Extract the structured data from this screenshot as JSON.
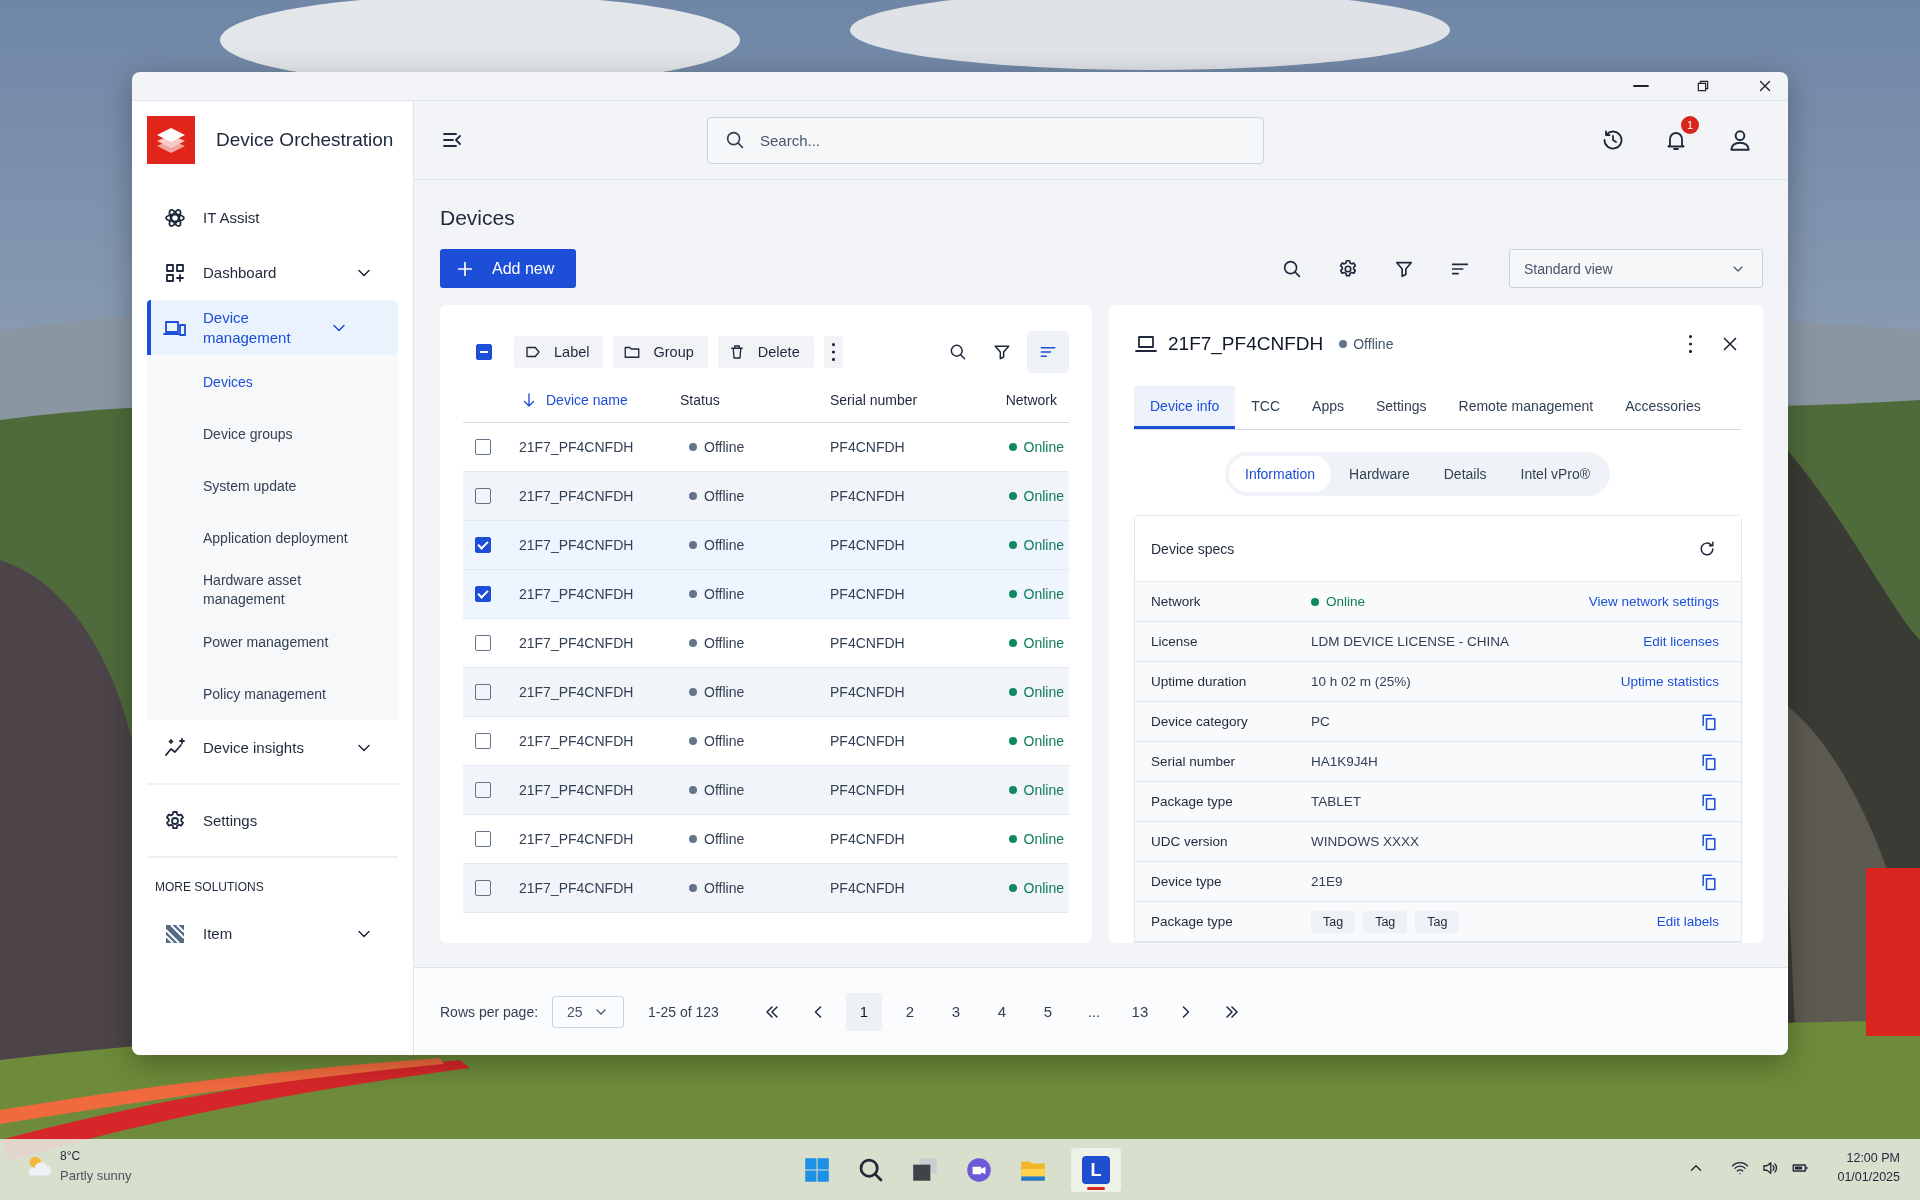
{
  "window": {
    "app_name": "Device Orchestration"
  },
  "sidebar": {
    "groups": [
      {
        "items": [
          {
            "label": "IT Assist",
            "selected": false,
            "expandable": false
          },
          {
            "label": "Dashboard",
            "selected": false,
            "expandable": true
          },
          {
            "label": "Device management",
            "selected": true,
            "expandable": true,
            "children": [
              {
                "label": "Devices",
                "selected": true
              },
              {
                "label": "Device groups",
                "selected": false
              },
              {
                "label": "System update",
                "selected": false
              },
              {
                "label": "Application deployment",
                "selected": false
              },
              {
                "label": "Hardware asset management",
                "selected": false
              },
              {
                "label": "Power management",
                "selected": false
              },
              {
                "label": "Policy management",
                "selected": false
              }
            ]
          },
          {
            "label": "Device insights",
            "selected": false,
            "expandable": true
          }
        ]
      },
      {
        "items": [
          {
            "label": "Settings",
            "selected": false,
            "expandable": false
          }
        ]
      },
      {
        "title": "MORE SOLUTIONS",
        "items": [
          {
            "label": "Item",
            "selected": false,
            "expandable": true
          }
        ]
      }
    ]
  },
  "header": {
    "search": {
      "placeholder": "Search..."
    },
    "notification_count": "1"
  },
  "page": {
    "title": "Devices",
    "add_button": "Add new",
    "view_select": "Standard view"
  },
  "table": {
    "select_all": {
      "indeterminate": true
    },
    "actions": [
      "Label",
      "Group",
      "Delete"
    ],
    "tools": [
      {
        "kind": "search",
        "active": false
      },
      {
        "kind": "filter",
        "active": false
      },
      {
        "kind": "sort",
        "active": true
      }
    ],
    "columns": [
      {
        "label": "Device name",
        "sorted": true
      },
      {
        "label": "Status",
        "sorted": false
      },
      {
        "label": "Serial number",
        "sorted": false
      },
      {
        "label": "Network",
        "sorted": false
      }
    ],
    "rows": [
      {
        "checked": false,
        "name": "21F7_PF4CNFDH",
        "status": "Offline",
        "status_online": false,
        "serial": "PF4CNFDH",
        "network": "Online",
        "network_online": true
      },
      {
        "checked": false,
        "name": "21F7_PF4CNFDH",
        "status": "Offline",
        "status_online": false,
        "serial": "PF4CNFDH",
        "network": "Online",
        "network_online": true
      },
      {
        "checked": true,
        "name": "21F7_PF4CNFDH",
        "status": "Offline",
        "status_online": false,
        "serial": "PF4CNFDH",
        "network": "Online",
        "network_online": true
      },
      {
        "checked": true,
        "name": "21F7_PF4CNFDH",
        "status": "Offline",
        "status_online": false,
        "serial": "PF4CNFDH",
        "network": "Online",
        "network_online": true
      },
      {
        "checked": false,
        "name": "21F7_PF4CNFDH",
        "status": "Offline",
        "status_online": false,
        "serial": "PF4CNFDH",
        "network": "Online",
        "network_online": true
      },
      {
        "checked": false,
        "name": "21F7_PF4CNFDH",
        "status": "Offline",
        "status_online": false,
        "serial": "PF4CNFDH",
        "network": "Online",
        "network_online": true
      },
      {
        "checked": false,
        "name": "21F7_PF4CNFDH",
        "status": "Offline",
        "status_online": false,
        "serial": "PF4CNFDH",
        "network": "Online",
        "network_online": true
      },
      {
        "checked": false,
        "name": "21F7_PF4CNFDH",
        "status": "Offline",
        "status_online": false,
        "serial": "PF4CNFDH",
        "network": "Online",
        "network_online": true
      },
      {
        "checked": false,
        "name": "21F7_PF4CNFDH",
        "status": "Offline",
        "status_online": false,
        "serial": "PF4CNFDH",
        "network": "Online",
        "network_online": true
      },
      {
        "checked": false,
        "name": "21F7_PF4CNFDH",
        "status": "Offline",
        "status_online": false,
        "serial": "PF4CNFDH",
        "network": "Online",
        "network_online": true
      }
    ]
  },
  "detail": {
    "title": "21F7_PF4CNFDH",
    "status": "Offline",
    "status_online": false,
    "tabs": [
      {
        "label": "Device info",
        "selected": true
      },
      {
        "label": "TCC",
        "selected": false
      },
      {
        "label": "Apps",
        "selected": false
      },
      {
        "label": "Settings",
        "selected": false
      },
      {
        "label": "Remote management",
        "selected": false
      },
      {
        "label": "Accessories",
        "selected": false
      }
    ],
    "subtabs": [
      {
        "label": "Information",
        "selected": true
      },
      {
        "label": "Hardware",
        "selected": false
      },
      {
        "label": "Details",
        "selected": false
      },
      {
        "label": "Intel vPro®",
        "selected": false
      }
    ],
    "specs": {
      "title": "Device specs",
      "rows": [
        {
          "label": "Network",
          "kind": "status",
          "value": "Online",
          "online": true,
          "action": "View network settings",
          "copyable": false
        },
        {
          "label": "License",
          "kind": "text",
          "value": "LDM DEVICE LICENSE - CHINA",
          "action": "Edit licenses",
          "copyable": false
        },
        {
          "label": "Uptime duration",
          "kind": "text",
          "value": "10 h 02 m (25%)",
          "action": "Uptime statistics",
          "copyable": false
        },
        {
          "label": "Device category",
          "kind": "text",
          "value": "PC",
          "copyable": true
        },
        {
          "label": "Serial number",
          "kind": "text",
          "value": "HA1K9J4H",
          "copyable": true
        },
        {
          "label": "Package type",
          "kind": "text",
          "value": "TABLET",
          "copyable": true
        },
        {
          "label": "UDC version",
          "kind": "text",
          "value": "WINDOWS XXXX",
          "copyable": true
        },
        {
          "label": "Device type",
          "kind": "text",
          "value": "21E9",
          "copyable": true
        },
        {
          "label": "Package type",
          "kind": "tags",
          "tags": [
            "Tag",
            "Tag",
            "Tag"
          ],
          "action": "Edit labels",
          "copyable": false
        }
      ]
    }
  },
  "pagination": {
    "rows_label": "Rows per page:",
    "rows_value": "25",
    "range": "1-25 of 123",
    "pages": [
      {
        "label": "1",
        "selected": true
      },
      {
        "label": "2",
        "selected": false
      },
      {
        "label": "3",
        "selected": false
      },
      {
        "label": "4",
        "selected": false
      },
      {
        "label": "5",
        "selected": false
      },
      {
        "label": "...",
        "selected": false
      },
      {
        "label": "13",
        "selected": false
      }
    ]
  },
  "taskbar": {
    "weather": {
      "temp": "8°C",
      "condition": "Partly sunny"
    },
    "apps": [
      {
        "kind": "start",
        "selected": false
      },
      {
        "kind": "search",
        "selected": false
      },
      {
        "kind": "taskview",
        "selected": false
      },
      {
        "kind": "chat",
        "selected": false
      },
      {
        "kind": "files",
        "selected": false
      },
      {
        "kind": "app",
        "label": "L",
        "selected": true
      }
    ],
    "time": "12:00 PM",
    "date": "01/01/2025"
  }
}
